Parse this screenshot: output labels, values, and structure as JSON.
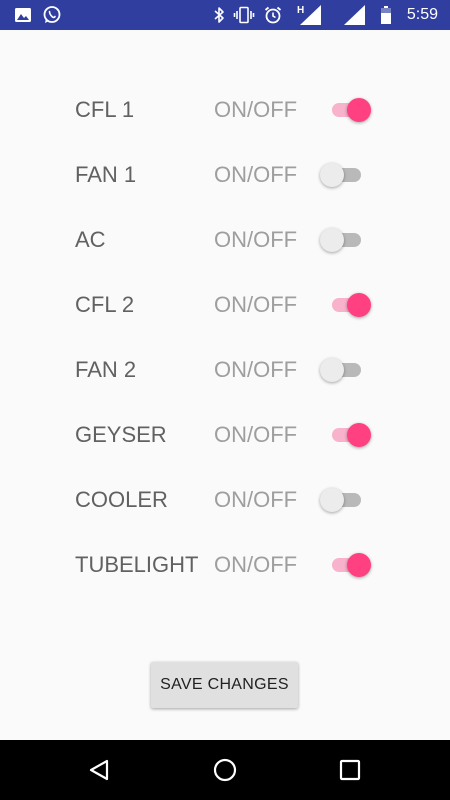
{
  "status_bar": {
    "time": "5:59",
    "left_icons": [
      "image-icon",
      "whatsapp-icon"
    ],
    "right_icons": [
      "bluetooth-icon",
      "vibrate-icon",
      "alarm-icon",
      "signal-h-icon",
      "signal-r-icon",
      "battery-icon"
    ],
    "signal_h_label": "H",
    "signal_r_label": "R",
    "color": "#303f9f"
  },
  "devices": [
    {
      "label": "CFL 1",
      "switch_label": "ON/OFF",
      "on": true
    },
    {
      "label": "FAN 1",
      "switch_label": "ON/OFF",
      "on": false
    },
    {
      "label": "AC",
      "switch_label": "ON/OFF",
      "on": false
    },
    {
      "label": "CFL 2",
      "switch_label": "ON/OFF",
      "on": true
    },
    {
      "label": "FAN 2",
      "switch_label": "ON/OFF",
      "on": false
    },
    {
      "label": "GEYSER",
      "switch_label": "ON/OFF",
      "on": true
    },
    {
      "label": "COOLER",
      "switch_label": "ON/OFF",
      "on": false
    },
    {
      "label": "TUBELIGHT",
      "switch_label": "ON/OFF",
      "on": true
    }
  ],
  "save_button": {
    "label": "SAVE CHANGES"
  },
  "nav_bar": {
    "buttons": [
      "back-icon",
      "home-icon",
      "recents-icon"
    ]
  },
  "colors": {
    "accent": "#ff4081",
    "accent_track": "#f8b2cc",
    "off_thumb": "#ececec",
    "off_track": "#b9b9b9",
    "label": "#616161",
    "switch_text": "#9e9e9e"
  }
}
